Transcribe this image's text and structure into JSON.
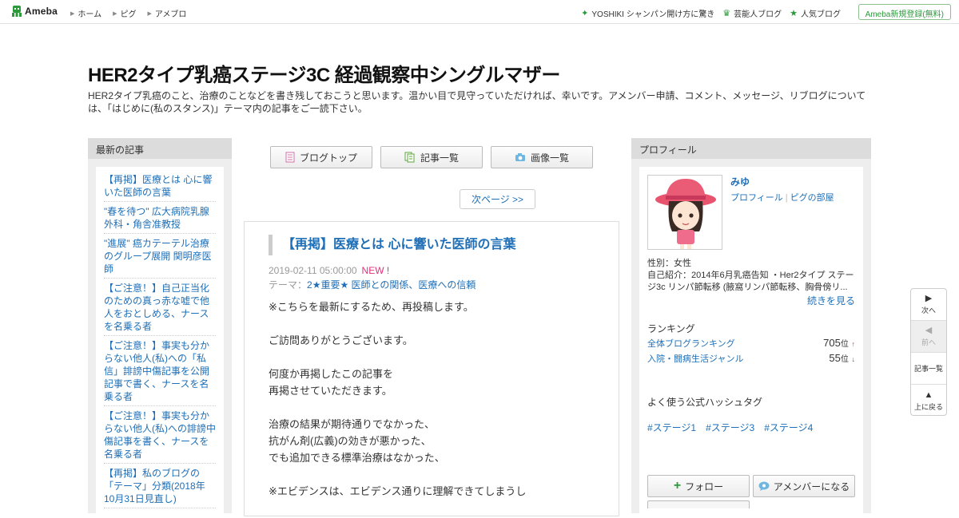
{
  "topbar": {
    "logo": "Ameba",
    "nav": [
      "ホーム",
      "ピグ",
      "アメブロ"
    ],
    "right_links": [
      {
        "icon": "sparkle-icon",
        "label": "YOSHIKI シャンパン開け方に驚き"
      },
      {
        "icon": "crown-icon",
        "label": "芸能人ブログ"
      },
      {
        "icon": "star-icon",
        "label": "人気ブログ"
      }
    ],
    "register": "Ameba新規登録(無料)"
  },
  "header": {
    "title": "HER2タイプ乳癌ステージ3C 経過観察中シングルマザー",
    "description": "HER2タイプ乳癌のこと、治療のことなどを書き残しておこうと思います。温かい目で見守っていただければ、幸いです。アメンバー申請、コメント、メッセージ、リブログについては、「はじめに(私のスタンス)」テーマ内の記事をご一読下さい。"
  },
  "sidebar_left": {
    "heading": "最新の記事",
    "items": [
      "【再掲】医療とは 心に響いた医師の言葉",
      "\"春を待つ\" 広大病院乳腺外科・角舎准教授",
      "\"進展\" 癌カテーテル治療のグループ展開 関明彦医師",
      "【ご注意！】自己正当化のための真っ赤な嘘で他人をおとしめる、ナースを名乗る者",
      "【ご注意！】事実も分からない他人(私)への「私信」誹謗中傷記事を公開記事で書く、ナースを名乗る者",
      "【ご注意！】事実も分からない他人(私)への誹謗中傷記事を書く、ナースを名乗る者",
      "【再掲】私のブログの「テーマ」分類(2018年10月31日見直し)"
    ]
  },
  "tabs": [
    {
      "icon": "document-icon",
      "label": "ブログトップ"
    },
    {
      "icon": "copy-icon",
      "label": "記事一覧"
    },
    {
      "icon": "camera-icon",
      "label": "画像一覧"
    }
  ],
  "pager": {
    "next": "次ページ >>"
  },
  "article": {
    "title": "【再掲】医療とは 心に響いた医師の言葉",
    "date": "2019-02-11 05:00:00",
    "new_badge": "NEW !",
    "theme_prefix": "テーマ：",
    "theme": "2★重要★ 医師との関係、医療への信頼",
    "paragraphs": [
      [
        "※こちらを最新にするため、再投稿します。"
      ],
      [
        "ご訪問ありがとうございます。"
      ],
      [
        "何度か再掲したこの記事を",
        "再掲させていただきます。"
      ],
      [
        "治療の結果が期待通りでなかった、",
        "抗がん剤(広義)の効きが悪かった、",
        "でも追加できる標準治療はなかった、"
      ],
      [
        "※エビデンスは、エビデンス通りに理解できてしまうし"
      ]
    ]
  },
  "profile": {
    "heading": "プロフィール",
    "name": "みゆ",
    "link_profile": "プロフィール",
    "link_room": "ピグの部屋",
    "gender": "性別：女性",
    "intro": "自己紹介：2014年6月乳癌告知 ・Her2タイプ ステージ3c リンパ節転移 (腋窩リンパ節転移、胸骨傍リ...",
    "more": "続きを見る",
    "ranking_heading": "ランキング",
    "rankings": [
      {
        "label": "全体ブログランキング",
        "value": "705",
        "unit": "位",
        "trend": "↑"
      },
      {
        "label": "入院・闘病生活ジャンル",
        "value": "55",
        "unit": "位",
        "trend": "↓"
      }
    ],
    "hashtag_heading": "よく使う公式ハッシュタグ",
    "hashtags": [
      "#ステージ1",
      "#ステージ3",
      "#ステージ4"
    ],
    "follow": "フォロー",
    "amember": "アメンバーになる"
  },
  "float_nav": [
    {
      "icon": "triangle-right-icon",
      "label": "次へ",
      "disabled": false
    },
    {
      "icon": "triangle-left-icon",
      "label": "前へ",
      "disabled": true
    },
    {
      "icon": "",
      "label": "記事一覧",
      "disabled": false
    },
    {
      "icon": "triangle-up-icon",
      "label": "上に戻る",
      "disabled": false
    }
  ],
  "colors": {
    "link": "#1e6fb7",
    "brand_green": "#2a9a3a",
    "new_badge": "#e0307a"
  }
}
